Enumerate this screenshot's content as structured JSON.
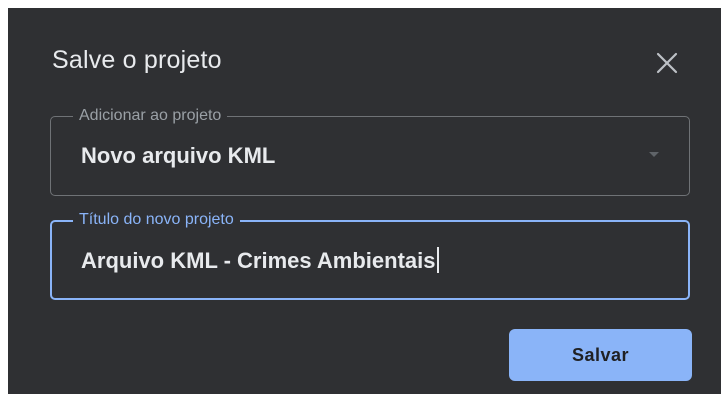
{
  "dialog": {
    "title": "Salve o projeto",
    "close_icon": "close-icon"
  },
  "project_select": {
    "label": "Adicionar ao projeto",
    "value": "Novo arquivo KML",
    "icon": "dropdown-arrow-icon"
  },
  "title_input": {
    "label": "Título do novo projeto",
    "value": "Arquivo KML - Crimes Ambientais",
    "focused": true
  },
  "actions": {
    "save_label": "Salvar"
  },
  "colors": {
    "dialog_background": "#2f3033",
    "accent": "#8ab4f8",
    "text": "#e8eaed",
    "muted_text": "#9aa0a6"
  }
}
